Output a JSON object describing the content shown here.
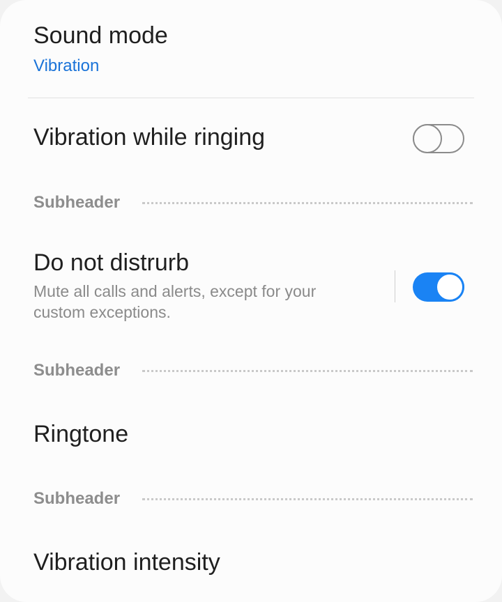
{
  "sound_mode": {
    "title": "Sound mode",
    "value": "Vibration"
  },
  "vibration_while_ringing": {
    "title": "Vibration while ringing",
    "enabled": false
  },
  "subheaders": [
    "Subheader",
    "Subheader",
    "Subheader"
  ],
  "do_not_disturb": {
    "title": "Do not distrurb",
    "summary": "Mute all calls and alerts, except for your custom exceptions.",
    "enabled": true
  },
  "ringtone": {
    "title": "Ringtone"
  },
  "vibration_intensity": {
    "title": "Vibration intensity"
  },
  "colors": {
    "accent": "#1a83f4",
    "link_blue": "#1a73d8",
    "subheader_gray": "#8d8d8d"
  }
}
